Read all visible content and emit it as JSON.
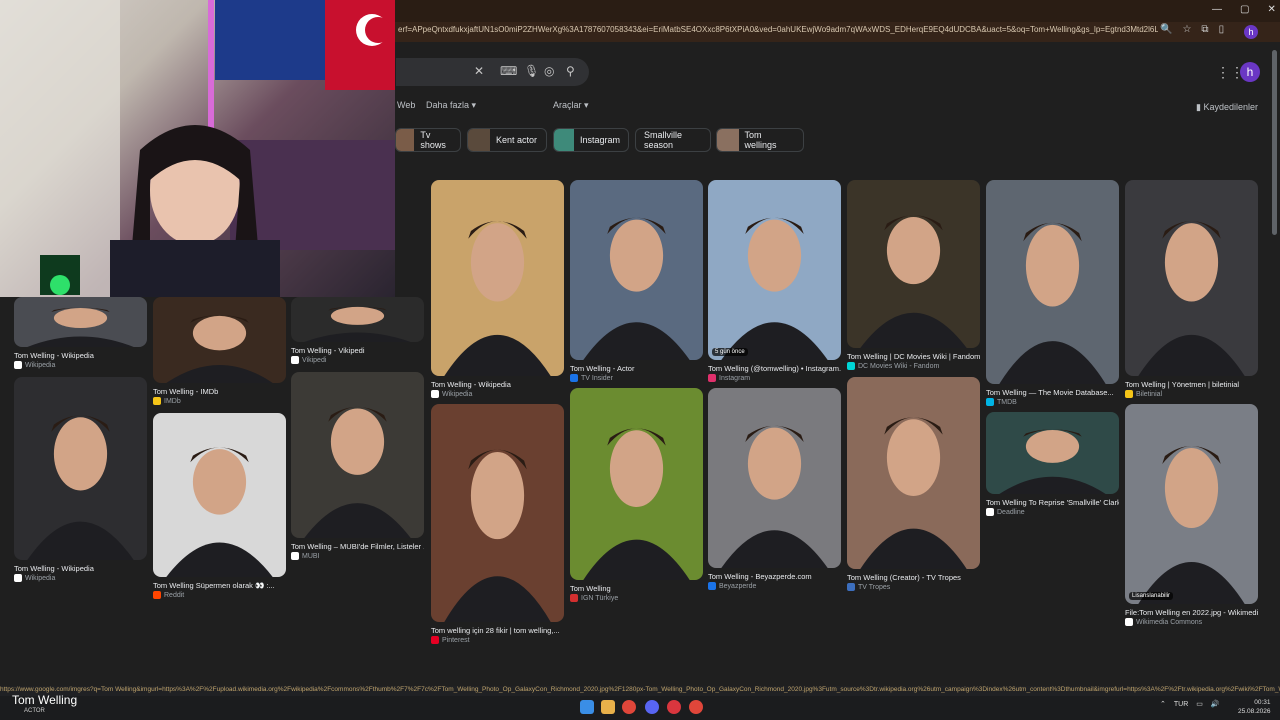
{
  "browser": {
    "url": "erf=APpeQntxdfukxjaftUN1sO0miP2ZHWerXg%3A1787607058343&ei=EriMatbSE4OXxc8P6tXPiA0&ved=0ahUKEwjWo9adm7qWAxWDS_EDHerqE9EQ4dUDCBA&uact=5&oq=Tom+Welling&gs_lp=Egtnd3Mtd2l6LWltZyILVG9tIFdlbGxpbmcoAZIE...",
    "profile_letter": "h"
  },
  "google": {
    "nav_web": "Web",
    "nav_more": "Daha fazla ▾",
    "nav_tools": "Araçlar ▾",
    "saved": "Kaydedilenler",
    "avatar_letter": "h",
    "chips": [
      {
        "label": "Tv shows"
      },
      {
        "label": "Kent actor"
      },
      {
        "label": "Instagram"
      },
      {
        "label": "Smallville season"
      },
      {
        "label": "Tom wellings"
      }
    ]
  },
  "results": [
    {
      "caption": "Tom Welling - Wikipedia",
      "source": "Wikipedia",
      "fav": "#ffffff",
      "color": "#4a4c52"
    },
    {
      "caption": "Tom Welling - IMDb",
      "source": "IMDb",
      "fav": "#f5c518",
      "color": "#3a2a20"
    },
    {
      "caption": "Tom Welling - Vikipedi",
      "source": "Vikipedi",
      "fav": "#ffffff",
      "color": "#2b2b2b"
    },
    {
      "caption": "Tom Welling - Wikipedia",
      "source": "Wikipedia",
      "fav": "#ffffff",
      "color": "#c9a36a"
    },
    {
      "caption": "Tom Welling - Actor",
      "source": "TV Insider",
      "fav": "#1a73e8",
      "color": "#5a6a80"
    },
    {
      "caption": "Tom Welling (@tomwelling) • Instagram...",
      "source": "Instagram",
      "fav": "#e1306c",
      "color": "#8fa8c4",
      "badge": "5 gün önce"
    },
    {
      "caption": "Tom Welling | DC Movies Wiki | Fandom",
      "source": "DC Movies Wiki - Fandom",
      "fav": "#00d6d6",
      "color": "#3b3428"
    },
    {
      "caption": "Tom Welling — The Movie Database...",
      "source": "TMDB",
      "fav": "#01b4e4",
      "color": "#5e6670"
    },
    {
      "caption": "Tom Welling | Yönetmen | biletinial",
      "source": "Biletinial",
      "fav": "#f5c518",
      "color": "#3a3a3e"
    },
    {
      "caption": "Tom Welling - Wikipedia",
      "source": "Wikipedia",
      "fav": "#ffffff",
      "color": "#2d2d30"
    },
    {
      "caption": "Tom Welling Süpermen olarak 👀 :...",
      "source": "Reddit",
      "fav": "#ff4500",
      "color": "#d8d8d8"
    },
    {
      "caption": "Tom Welling – MUBI'de Filmler, Listeler ...",
      "source": "MUBI",
      "fav": "#ffffff",
      "color": "#3c3a36"
    },
    {
      "caption": "Tom welling için 28 fikir | tom welling,...",
      "source": "Pinterest",
      "fav": "#e60023",
      "color": "#6a4030"
    },
    {
      "caption": "Tom Welling",
      "source": "IGN Türkiye",
      "fav": "#d32f2f",
      "color": "#6b8c30"
    },
    {
      "caption": "Tom Welling - Beyazperde.com",
      "source": "Beyazperde",
      "fav": "#1a73e8",
      "color": "#7a7a7e"
    },
    {
      "caption": "Tom Welling (Creator) - TV Tropes",
      "source": "TV Tropes",
      "fav": "#3c6ebd",
      "color": "#8a6a5a"
    },
    {
      "caption": "Tom Welling To Reprise 'Smallville' Clark...",
      "source": "Deadline",
      "fav": "#ffffff",
      "color": "#2f4a48"
    },
    {
      "caption": "File:Tom Welling en 2022.jpg - Wikimedi...",
      "source": "Wikimedia Commons",
      "fav": "#ffffff",
      "color": "#7a7e86",
      "badge": "Lisanslanabilir"
    }
  ],
  "status_bar": {
    "url": "https://www.google.com/imgres?q=Tom Welling&imgurl=https%3A%2F%2Fupload.wikimedia.org%2Fwikipedia%2Fcommons%2Fthumb%2F7%2F7c%2FTom_Welling_Photo_Op_GalaxyCon_Richmond_2020.jpg%2F1280px-Tom_Welling_Photo_Op_GalaxyCon_Richmond_2020.jpg%3Futm_source%3Dtr.wikipedia.org%26utm_campaign%3Dindex%26utm_content%3Dthumbnail&imgrefurl=https%3A%2F%2Ftr.wikipedia.org%2Fwiki%2FTom_Welling&docid=TBrJ-NAitwgyM&tbn..."
  },
  "overlay": {
    "name": "Tom Welling",
    "sub": "ACTOR"
  },
  "taskbar": {
    "lang": "TUR",
    "time": "00:31",
    "date": "25.08.2026"
  }
}
